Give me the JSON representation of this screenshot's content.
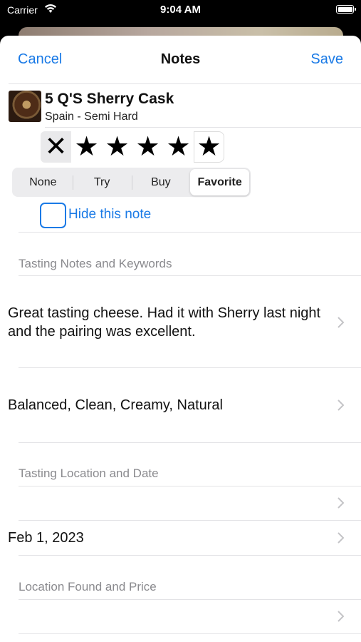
{
  "status_bar": {
    "carrier": "Carrier",
    "time": "9:04 AM"
  },
  "nav": {
    "cancel": "Cancel",
    "title": "Notes",
    "save": "Save"
  },
  "cheese": {
    "name": "5 Q'S Sherry Cask",
    "subtitle": "Spain - Semi Hard"
  },
  "rating": {
    "clear_symbol": "✕",
    "star_symbol": "★",
    "value": 5,
    "max": 5
  },
  "status_options": [
    "None",
    "Try",
    "Buy",
    "Favorite"
  ],
  "selected_status": "Favorite",
  "hide_note": {
    "label": "Hide this note",
    "checked": false
  },
  "sections": {
    "tasting_notes": "Tasting Notes and Keywords",
    "tasting_location": "Tasting Location and Date",
    "location_found": "Location Found and Price"
  },
  "cells": {
    "notes": "Great tasting cheese. Had it with Sherry last night and the pairing was excellent.",
    "keywords": "Balanced, Clean, Creamy, Natural",
    "tasting_location": "",
    "tasting_date": "Feb 1, 2023",
    "found_location": ""
  },
  "colors": {
    "accent": "#1a7ae6",
    "section_header": "#8a8a8e"
  }
}
